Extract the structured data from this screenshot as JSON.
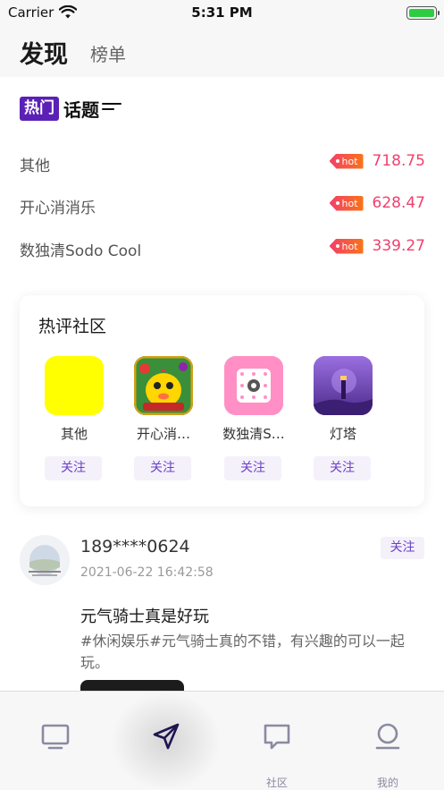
{
  "status_bar": {
    "carrier": "Carrier",
    "time": "5:31 PM"
  },
  "header": {
    "active_tab": "发现",
    "other_tab": "榜单"
  },
  "hot_topics": {
    "logo_box_text": "热门",
    "logo_text": "话题",
    "badge_text": "hot",
    "items": [
      {
        "name": "其他",
        "score": "718.75"
      },
      {
        "name": "开心消消乐",
        "score": "628.47"
      },
      {
        "name": "数独清Sodo Cool",
        "score": "339.27"
      }
    ]
  },
  "hot_community": {
    "title": "热评社区",
    "follow_label": "关注",
    "items": [
      {
        "name": "其他",
        "icon": "yellow-square-icon",
        "color": "#ffff00"
      },
      {
        "name": "开心消…",
        "icon": "chick-game-icon",
        "color": "#f5c518"
      },
      {
        "name": "数独清S…",
        "icon": "sudoku-app-icon",
        "color": "#ff8fc5"
      },
      {
        "name": "灯塔",
        "icon": "lighthouse-app-icon",
        "color": "#7b4fc7"
      }
    ]
  },
  "post": {
    "user": "189****0624",
    "follow_label": "关注",
    "time": "2021-06-22 16:42:58",
    "title": "元气骑士真是好玩",
    "body": "#休闲娱乐#元气骑士真的不错，有兴趣的可以一起玩。"
  },
  "tab_bar": {
    "items": [
      {
        "label": "",
        "icon": "monitor-icon"
      },
      {
        "label": "",
        "icon": "send-icon"
      },
      {
        "label": "社区",
        "icon": "chat-bubble-icon"
      },
      {
        "label": "我的",
        "icon": "profile-icon"
      }
    ]
  },
  "colors": {
    "accent_purple": "#5b21b6",
    "hot_pink": "#f0406e",
    "follow_text": "#6d3fc8"
  }
}
